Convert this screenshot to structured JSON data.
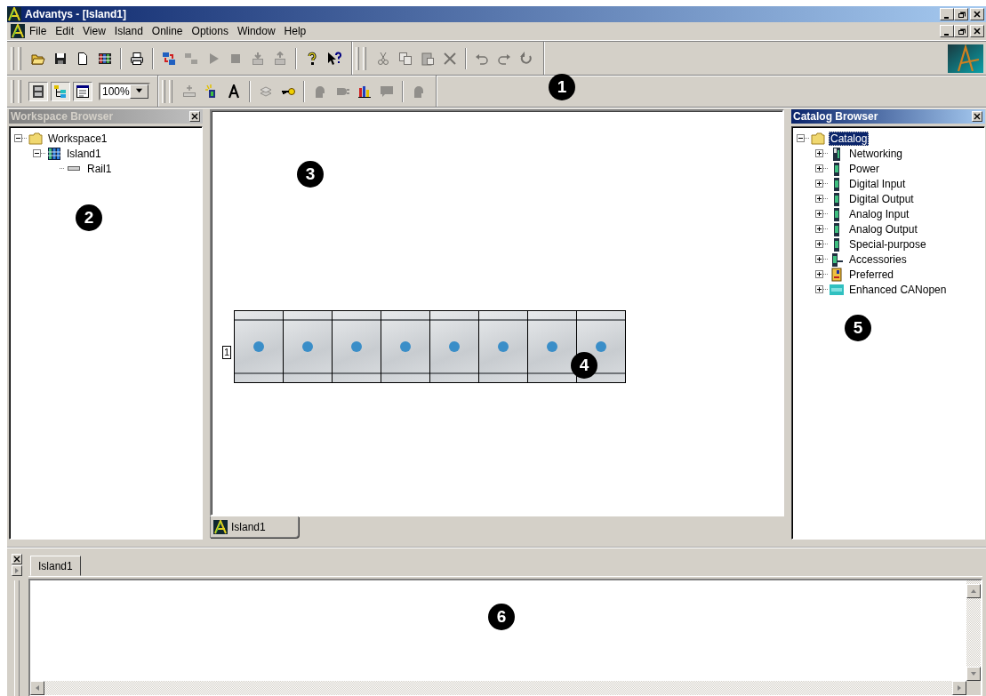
{
  "window": {
    "title": "Advantys - [Island1]"
  },
  "menu": [
    "File",
    "Edit",
    "View",
    "Island",
    "Online",
    "Options",
    "Window",
    "Help"
  ],
  "toolbar_rows": [
    [
      {
        "items": [
          {
            "kind": "open",
            "disabled": false
          },
          {
            "kind": "save",
            "disabled": false
          },
          {
            "kind": "new",
            "disabled": false
          },
          {
            "kind": "grid",
            "disabled": false
          },
          {
            "kind": "separator"
          },
          {
            "kind": "print",
            "disabled": false
          },
          {
            "kind": "separator"
          },
          {
            "kind": "connect",
            "disabled": false
          },
          {
            "kind": "build",
            "disabled": true
          },
          {
            "kind": "play",
            "disabled": true
          },
          {
            "kind": "stop",
            "disabled": true
          },
          {
            "kind": "download",
            "disabled": true
          },
          {
            "kind": "upload",
            "disabled": true
          },
          {
            "kind": "separator"
          },
          {
            "kind": "help",
            "disabled": false
          },
          {
            "kind": "context-help",
            "disabled": false
          }
        ]
      },
      {
        "items": [
          {
            "kind": "cut",
            "disabled": true
          },
          {
            "kind": "copy",
            "disabled": true
          },
          {
            "kind": "paste",
            "disabled": true
          },
          {
            "kind": "delete",
            "disabled": true
          },
          {
            "kind": "separator"
          },
          {
            "kind": "undo",
            "disabled": true
          },
          {
            "kind": "redo",
            "disabled": true
          },
          {
            "kind": "refresh",
            "disabled": true
          }
        ]
      }
    ],
    [
      {
        "items": [
          {
            "kind": "browser",
            "disabled": false,
            "pressed": true
          },
          {
            "kind": "tree",
            "disabled": false,
            "pressed": true
          },
          {
            "kind": "properties",
            "disabled": false,
            "pressed": true
          },
          {
            "kind": "zoom",
            "value": "100%"
          }
        ]
      },
      {
        "items": [
          {
            "kind": "insert",
            "disabled": true
          },
          {
            "kind": "light",
            "disabled": false
          },
          {
            "kind": "text",
            "disabled": false
          },
          {
            "kind": "separator"
          },
          {
            "kind": "stack",
            "disabled": true
          },
          {
            "kind": "key",
            "disabled": false
          },
          {
            "kind": "separator"
          },
          {
            "kind": "head",
            "disabled": true
          },
          {
            "kind": "plug",
            "disabled": true
          },
          {
            "kind": "chart",
            "disabled": false
          },
          {
            "kind": "comment",
            "disabled": true
          },
          {
            "kind": "separator"
          },
          {
            "kind": "head",
            "disabled": true
          }
        ]
      }
    ]
  ],
  "workspace_browser": {
    "title": "Workspace Browser",
    "active": false,
    "tree": [
      {
        "label": "Workspace1",
        "kind": "folder",
        "expanded": true,
        "selected": false,
        "children": [
          {
            "label": "Island1",
            "kind": "island",
            "expanded": true,
            "selected": false,
            "children": [
              {
                "label": "Rail1",
                "kind": "rail",
                "selected": false
              }
            ]
          }
        ]
      }
    ]
  },
  "editor": {
    "island": {
      "rail_label": "1",
      "modules": [
        {
          "kind": "blank"
        },
        {
          "kind": "blank"
        },
        {
          "kind": "blank"
        },
        {
          "kind": "blank"
        },
        {
          "kind": "blank"
        },
        {
          "kind": "blank"
        },
        {
          "kind": "blank"
        },
        {
          "kind": "blank"
        }
      ]
    },
    "tabs": [
      {
        "label": "Island1",
        "selected": true
      }
    ]
  },
  "catalog_browser": {
    "title": "Catalog Browser",
    "active": true,
    "tree": [
      {
        "label": "Catalog",
        "kind": "folder",
        "expanded": true,
        "selected": true,
        "children": [
          {
            "label": "Networking",
            "kind": "network",
            "expanded": false,
            "selected": false
          },
          {
            "label": "Power",
            "kind": "module",
            "expanded": false,
            "selected": false
          },
          {
            "label": "Digital Input",
            "kind": "module",
            "expanded": false,
            "selected": false
          },
          {
            "label": "Digital Output",
            "kind": "module",
            "expanded": false,
            "selected": false
          },
          {
            "label": "Analog Input",
            "kind": "module",
            "expanded": false,
            "selected": false
          },
          {
            "label": "Analog Output",
            "kind": "module",
            "expanded": false,
            "selected": false
          },
          {
            "label": "Special-purpose",
            "kind": "module",
            "expanded": false,
            "selected": false
          },
          {
            "label": "Accessories",
            "kind": "accessory",
            "expanded": false,
            "selected": false
          },
          {
            "label": "Preferred",
            "kind": "preferred",
            "expanded": false,
            "selected": false
          },
          {
            "label": "Enhanced CANopen",
            "kind": "can",
            "expanded": false,
            "selected": false
          }
        ]
      }
    ]
  },
  "output": {
    "tabs": [
      {
        "label": "Island1",
        "selected": true
      }
    ]
  },
  "callouts": [
    "1",
    "2",
    "3",
    "4",
    "5",
    "6"
  ]
}
